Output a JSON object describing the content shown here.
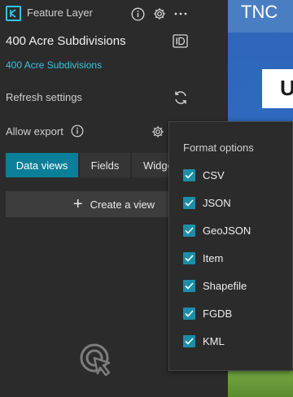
{
  "header": {
    "type_label": "Feature Layer"
  },
  "layer": {
    "title": "400 Acre Subdivisions",
    "link_text": "400 Acre Subdivisions"
  },
  "settings": {
    "refresh_label": "Refresh settings",
    "export_label": "Allow export"
  },
  "tabs": [
    {
      "label": "Data views",
      "active": true
    },
    {
      "label": "Fields",
      "active": false
    },
    {
      "label": "Widge",
      "active": false
    }
  ],
  "create_view_label": "Create a view",
  "map": {
    "header_text": "TNC",
    "card_text": "U"
  },
  "format_options": {
    "title": "Format options",
    "items": [
      {
        "label": "CSV",
        "checked": true
      },
      {
        "label": "JSON",
        "checked": true
      },
      {
        "label": "GeoJSON",
        "checked": true
      },
      {
        "label": "Item",
        "checked": true
      },
      {
        "label": "Shapefile",
        "checked": true
      },
      {
        "label": "FGDB",
        "checked": true
      },
      {
        "label": "KML",
        "checked": true
      }
    ]
  },
  "colors": {
    "accent": "#37c3e6",
    "active_tab": "#0b7f99",
    "checkbox": "#1c8ea8",
    "panel_bg": "#2b2b2b"
  }
}
